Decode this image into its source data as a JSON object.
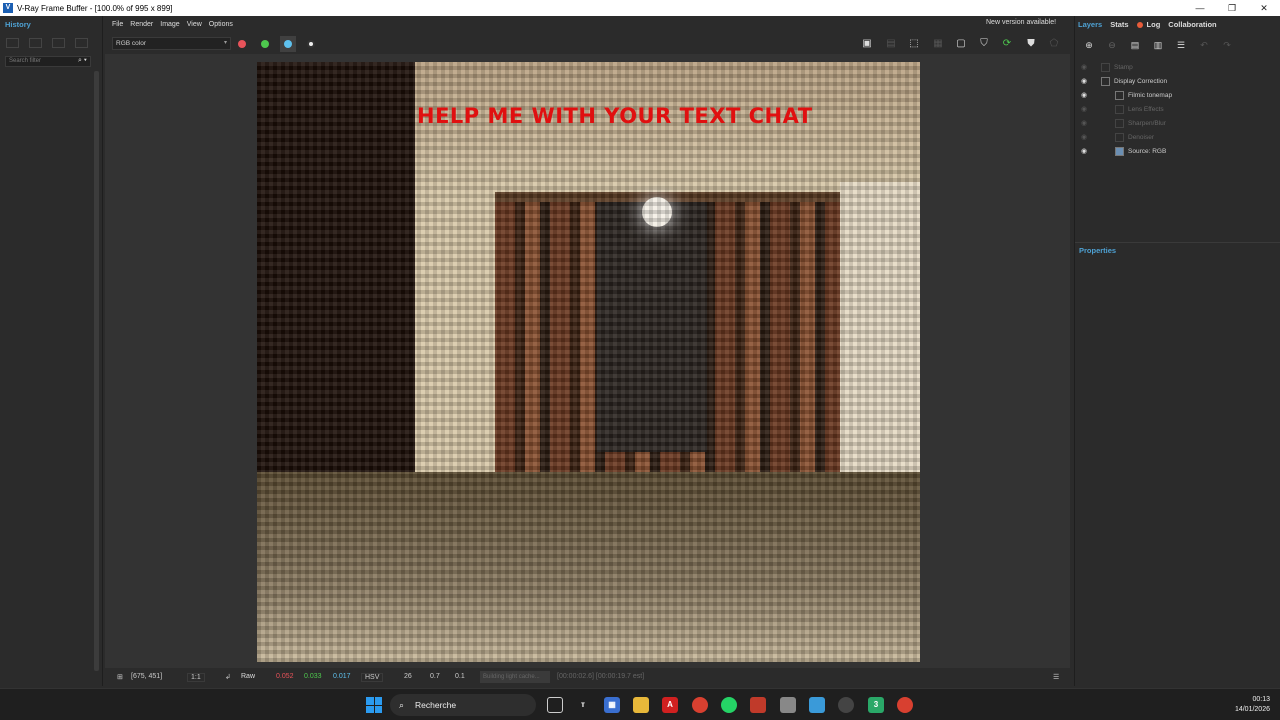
{
  "window": {
    "title": "V-Ray Frame Buffer - [100.0% of 995 x 899]",
    "app_icon": "V"
  },
  "menu": [
    "File",
    "Render",
    "Image",
    "View",
    "Options"
  ],
  "notice": "New version available!",
  "history": {
    "tab": "History",
    "search_placeholder": "Search filter"
  },
  "toolbar": {
    "channel": "RGB color",
    "channel_colors": {
      "red": "#e8535a",
      "green": "#4ec94e",
      "blue": "#5ec1ee"
    }
  },
  "render": {
    "overlay_text": "HELP ME WITH YOUR TEXT CHAT",
    "overlay_color": "#e01010"
  },
  "status": {
    "coords": "[675, 451]",
    "zoom": "1:1",
    "mode": "Raw",
    "r": "0.052",
    "g": "0.033",
    "b": "0.017",
    "colorspace": "HSV",
    "h": "26",
    "s": "0.7",
    "v": "0.1",
    "progress": "Building light cache...",
    "time": "[00:00:02.6] [00:00:19.7 est]"
  },
  "right_panel": {
    "tabs": [
      "Layers",
      "Stats",
      "Log",
      "Collaboration"
    ],
    "layers": [
      {
        "name": "Stamp",
        "visible": false,
        "enabled": false,
        "indent": 1
      },
      {
        "name": "Display Correction",
        "visible": true,
        "enabled": true,
        "indent": 1
      },
      {
        "name": "Filmic tonemap",
        "visible": true,
        "enabled": true,
        "indent": 2
      },
      {
        "name": "Lens Effects",
        "visible": false,
        "enabled": false,
        "indent": 2
      },
      {
        "name": "Sharpen/Blur",
        "visible": false,
        "enabled": false,
        "indent": 2
      },
      {
        "name": "Denoiser",
        "visible": false,
        "enabled": false,
        "indent": 2
      },
      {
        "name": "Source: RGB",
        "visible": true,
        "enabled": true,
        "indent": 2
      }
    ],
    "properties": "Properties"
  },
  "taskbar": {
    "search": "Recherche",
    "time": "00:13",
    "date": "14/01/2026"
  }
}
